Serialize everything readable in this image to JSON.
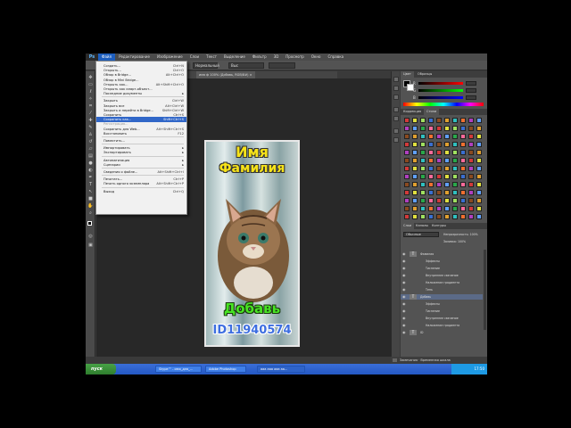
{
  "menubar": {
    "logo": "Ps",
    "items": [
      "Файл",
      "Редактирование",
      "Изображение",
      "Слои",
      "Текст",
      "Выделение",
      "Фильтр",
      "3D",
      "Просмотр",
      "Окно",
      "Справка"
    ],
    "active_index": 0
  },
  "optionsbar": {
    "field1": "Нормальный",
    "field2": "Выс"
  },
  "doc_tab": {
    "title": "имя ф 100% (Добавь, RGB/8#) ×"
  },
  "file_menu": {
    "items": [
      {
        "label": "Создать...",
        "shortcut": "Ctrl+N"
      },
      {
        "label": "Открыть...",
        "shortcut": "Ctrl+O"
      },
      {
        "label": "Обзор в Bridge...",
        "shortcut": "Alt+Ctrl+O"
      },
      {
        "label": "Обзор в Mini Bridge...",
        "shortcut": ""
      },
      {
        "label": "Открыть как...",
        "shortcut": "Alt+Shift+Ctrl+O"
      },
      {
        "label": "Открыть как смарт-объект...",
        "shortcut": ""
      },
      {
        "label": "Последние документы",
        "shortcut": "",
        "arrow": true
      },
      {
        "sep": true
      },
      {
        "label": "Закрыть",
        "shortcut": "Ctrl+W"
      },
      {
        "label": "Закрыть все",
        "shortcut": "Alt+Ctrl+W"
      },
      {
        "label": "Закрыть и перейти в Bridge...",
        "shortcut": "Shift+Ctrl+W"
      },
      {
        "label": "Сохранить",
        "shortcut": "Ctrl+S"
      },
      {
        "label": "Сохранить как...",
        "shortcut": "Shift+Ctrl+S",
        "highlight": true
      },
      {
        "label": "Регистрация...",
        "shortcut": "",
        "dim": true
      },
      {
        "label": "Сохранить для Web...",
        "shortcut": "Alt+Shift+Ctrl+S"
      },
      {
        "label": "Восстановить",
        "shortcut": "F12"
      },
      {
        "sep": true
      },
      {
        "label": "Поместить...",
        "shortcut": ""
      },
      {
        "sep": true
      },
      {
        "label": "Импортировать",
        "shortcut": "",
        "arrow": true
      },
      {
        "label": "Экспортировать",
        "shortcut": "",
        "arrow": true
      },
      {
        "sep": true
      },
      {
        "label": "Автоматизация",
        "shortcut": "",
        "arrow": true
      },
      {
        "label": "Сценарии",
        "shortcut": "",
        "arrow": true
      },
      {
        "sep": true
      },
      {
        "label": "Сведения о файле...",
        "shortcut": "Alt+Shift+Ctrl+I"
      },
      {
        "sep": true
      },
      {
        "label": "Печатать...",
        "shortcut": "Ctrl+P"
      },
      {
        "label": "Печать одного экземпляра",
        "shortcut": "Alt+Shift+Ctrl+P"
      },
      {
        "sep": true
      },
      {
        "label": "Выход",
        "shortcut": "Ctrl+Q"
      }
    ]
  },
  "artwork": {
    "name": "Имя",
    "surname": "Фамилия",
    "add": "Добавь",
    "id": "ID11940574"
  },
  "color_panel": {
    "tabs": [
      "Цвет",
      "Образцы"
    ],
    "labels": [
      "R",
      "G",
      "B"
    ]
  },
  "swatch_panel": {
    "tabs": [
      "Коррекция",
      "Стили"
    ]
  },
  "layers_panel": {
    "tabs": [
      "Слои",
      "Каналы",
      "Контуры"
    ],
    "blend_mode": "Обычные",
    "opacity_label": "Непрозрачность: 100%",
    "fill_label": "Заливка: 100%",
    "rows": [
      {
        "thumb": "T",
        "text": "Фамилия"
      },
      {
        "thumb": "",
        "text": "Эффекты"
      },
      {
        "thumb": "",
        "text": "Тиснение"
      },
      {
        "thumb": "",
        "text": "Внутреннее свечение"
      },
      {
        "thumb": "",
        "text": "Наложение градиента"
      },
      {
        "thumb": "",
        "text": "Тень"
      },
      {
        "thumb": "T",
        "text": "Добавь",
        "selected": true
      },
      {
        "thumb": "",
        "text": "Эффекты"
      },
      {
        "thumb": "",
        "text": "Тиснение"
      },
      {
        "thumb": "",
        "text": "Внутреннее свечение"
      },
      {
        "thumb": "",
        "text": "Наложение градиента"
      },
      {
        "thumb": "T",
        "text": "ID"
      }
    ]
  },
  "status": {
    "text": "Замечания · Временная шкала"
  },
  "taskbar": {
    "start": "пуск",
    "tasks": [
      "Skype™ - имя_для_...",
      "Adobe Photoshop",
      "ааа ааа ааа аа..."
    ],
    "clock": "17:50"
  },
  "colors": {
    "accent": "#3167c8",
    "name_text": "#f7e319",
    "add_text": "#48e324",
    "id_text": "#3d6ee0"
  }
}
